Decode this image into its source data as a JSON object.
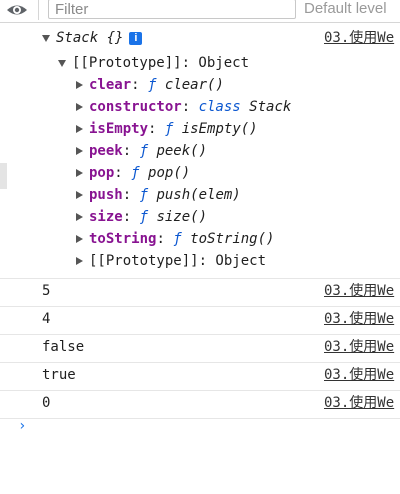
{
  "toolbar": {
    "filter_placeholder": "Filter",
    "levels_label": "Default level"
  },
  "object_entry": {
    "name": "Stack",
    "braces": "{}",
    "info_icon": "i",
    "source": "03.使用We",
    "prototype_label": "[[Prototype]]: Object",
    "members": [
      {
        "key": "clear",
        "sep": ": ",
        "marker": "ƒ",
        "value": "clear()"
      },
      {
        "key": "constructor",
        "sep": ": ",
        "marker": "class",
        "value": "Stack"
      },
      {
        "key": "isEmpty",
        "sep": ": ",
        "marker": "ƒ",
        "value": "isEmpty()"
      },
      {
        "key": "peek",
        "sep": ": ",
        "marker": "ƒ",
        "value": "peek()"
      },
      {
        "key": "pop",
        "sep": ": ",
        "marker": "ƒ",
        "value": "pop()"
      },
      {
        "key": "push",
        "sep": ": ",
        "marker": "ƒ",
        "value": "push(elem)"
      },
      {
        "key": "size",
        "sep": ": ",
        "marker": "ƒ",
        "value": "size()"
      },
      {
        "key": "toString",
        "sep": ": ",
        "marker": "ƒ",
        "value": "toString()"
      }
    ],
    "inner_prototype": "[[Prototype]]: Object"
  },
  "logs": [
    {
      "value": "5",
      "source": "03.使用We"
    },
    {
      "value": "4",
      "source": "03.使用We"
    },
    {
      "value": "false",
      "source": "03.使用We"
    },
    {
      "value": "true",
      "source": "03.使用We"
    },
    {
      "value": "0",
      "source": "03.使用We"
    }
  ],
  "prompt": "›"
}
